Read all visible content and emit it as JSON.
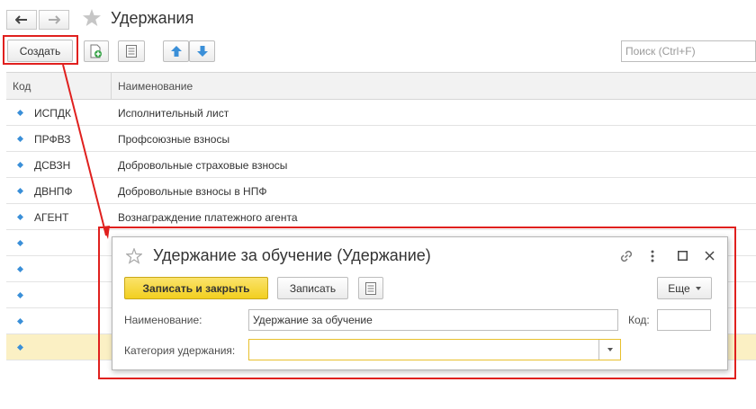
{
  "window": {
    "title": "Удержания"
  },
  "toolbar": {
    "create_label": "Создать",
    "search_placeholder": "Поиск (Ctrl+F)"
  },
  "table": {
    "columns": [
      "Код",
      "Наименование"
    ],
    "rows": [
      {
        "code": "ИСПДК",
        "name": "Исполнительный лист"
      },
      {
        "code": "ПРФВЗ",
        "name": "Профсоюзные взносы"
      },
      {
        "code": "ДСВЗН",
        "name": "Добровольные страховые взносы"
      },
      {
        "code": "ДВНПФ",
        "name": "Добровольные взносы в НПФ"
      },
      {
        "code": "АГЕНТ",
        "name": "Вознаграждение платежного агента"
      },
      {
        "code": "",
        "name": ""
      },
      {
        "code": "",
        "name": ""
      },
      {
        "code": "",
        "name": ""
      },
      {
        "code": "",
        "name": ""
      },
      {
        "code": "",
        "name": ""
      }
    ]
  },
  "dialog": {
    "title": "Удержание за обучение (Удержание)",
    "save_close_label": "Записать и закрыть",
    "save_label": "Записать",
    "more_label": "Еще",
    "name_label": "Наименование:",
    "name_value": "Удержание за обучение",
    "code_label": "Код:",
    "code_value": "",
    "category_label": "Категория удержания:",
    "category_value": ""
  },
  "colors": {
    "highlight": "#e0201e",
    "accent_yellow": "#f2cf1f",
    "selected_row": "#fbf0c4",
    "arrow_blue": "#3a8fd8"
  },
  "icons": [
    "back-arrow-icon",
    "forward-arrow-icon",
    "favorite-star-icon",
    "copy-add-icon",
    "list-icon",
    "move-up-icon",
    "move-down-icon",
    "link-icon",
    "more-vertical-icon",
    "maximize-icon",
    "close-icon",
    "dropdown-icon"
  ]
}
